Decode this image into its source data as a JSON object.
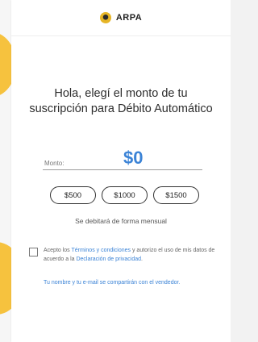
{
  "header": {
    "brand": "ARPA"
  },
  "main": {
    "title": "Hola, elegí el monto de tu suscripción para Débito Automático",
    "amount_label": "Monto:",
    "amount_value": "$0",
    "presets": [
      "$500",
      "$1000",
      "$1500"
    ],
    "frequency_note": "Se debitará de forma mensual"
  },
  "consent": {
    "text_1": "Acepto los ",
    "terms_link": "Términos y condiciones",
    "text_2": " y autorizo el uso de mis datos de acuerdo a la ",
    "privacy_link": "Declaración de privacidad",
    "text_3": "."
  },
  "share_note": "Tu nombre y tu e-mail se compartirán con el vendedor.",
  "colors": {
    "accent": "#3b83d6",
    "brand_yellow": "#f6c23e"
  }
}
